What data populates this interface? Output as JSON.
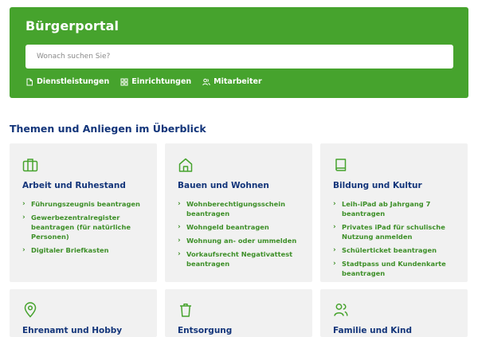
{
  "colors": {
    "brand_green": "#46a32d",
    "link_green": "#3d8f28",
    "heading_blue": "#13357a",
    "card_bg": "#f1f1f1"
  },
  "header": {
    "title": "Bürgerportal",
    "search": {
      "placeholder": "Wonach suchen Sie?",
      "value": ""
    },
    "nav": [
      {
        "label": "Dienstleistungen",
        "icon": "document-icon"
      },
      {
        "label": "Einrichtungen",
        "icon": "grid-icon"
      },
      {
        "label": "Mitarbeiter",
        "icon": "people-icon"
      }
    ]
  },
  "main": {
    "section_title": "Themen und Anliegen im Überblick",
    "cards": [
      {
        "icon": "briefcase-icon",
        "title": "Arbeit und Ruhestand",
        "links": [
          "Führungszeugnis beantragen",
          "Gewerbezentralregister beantragen (für natürliche Personen)",
          "Digitaler Briefkasten"
        ]
      },
      {
        "icon": "house-icon",
        "title": "Bauen und Wohnen",
        "links": [
          "Wohnberechtigungsschein beantragen",
          "Wohngeld beantragen",
          "Wohnung an- oder ummelden",
          "Vorkaufsrecht Negativattest beantragen"
        ]
      },
      {
        "icon": "book-icon",
        "title": "Bildung und Kultur",
        "links": [
          "Leih-iPad ab Jahrgang 7 beantragen",
          "Privates iPad für schulische Nutzung anmelden",
          "Schülerticket beantragen",
          "Stadtpass und Kundenkarte beantragen"
        ]
      },
      {
        "icon": "map-pin-icon",
        "title": "Ehrenamt und Hobby",
        "links": []
      },
      {
        "icon": "trash-icon",
        "title": "Entsorgung",
        "links": []
      },
      {
        "icon": "family-icon",
        "title": "Familie und Kind",
        "links": []
      }
    ]
  }
}
